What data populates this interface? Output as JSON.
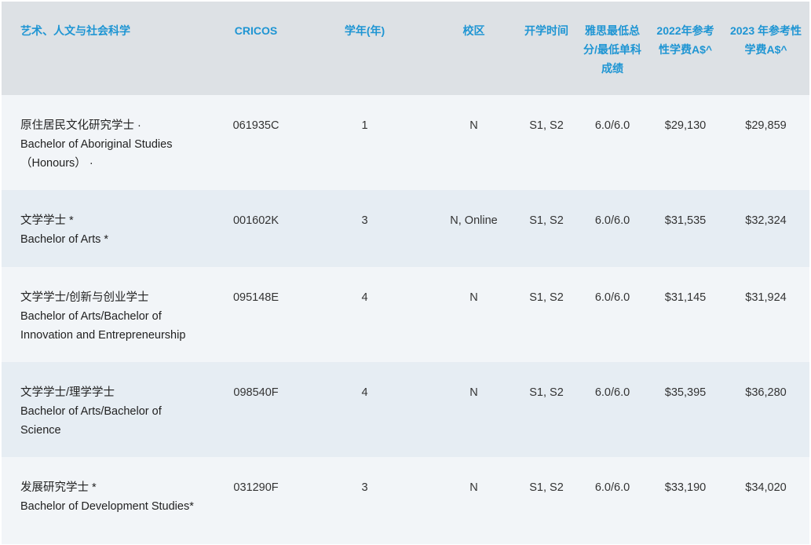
{
  "table": {
    "headers": {
      "program": "艺术、人文与社会科学",
      "cricos": "CRICOS",
      "years": "学年(年)",
      "campus": "校区",
      "intake": "开学时间",
      "ielts": "雅思最低总分/最低单科成绩",
      "fee2022": "2022年参考性学费A$^",
      "fee2023": "2023 年参考性学费A$^"
    },
    "rows": [
      {
        "name_cn": "原住居民文化研究学士 ·",
        "name_en": "Bachelor of Aboriginal Studies （Honours） ·",
        "cricos": "061935C",
        "years": "1",
        "campus": "N",
        "intake": "S1, S2",
        "ielts": "6.0/6.0",
        "fee2022": "$29,130",
        "fee2023": "$29,859"
      },
      {
        "name_cn": "文学学士 *",
        "name_en": "Bachelor of Arts *",
        "cricos": "001602K",
        "years": "3",
        "campus": "N, Online",
        "intake": "S1, S2",
        "ielts": "6.0/6.0",
        "fee2022": "$31,535",
        "fee2023": "$32,324"
      },
      {
        "name_cn": "文学学士/创新与创业学士",
        "name_en": "Bachelor of Arts/Bachelor of Innovation and Entrepreneurship",
        "cricos": "095148E",
        "years": "4",
        "campus": "N",
        "intake": "S1, S2",
        "ielts": "6.0/6.0",
        "fee2022": "$31,145",
        "fee2023": "$31,924"
      },
      {
        "name_cn": "文学学士/理学学士",
        "name_en": "Bachelor of Arts/Bachelor of Science",
        "cricos": "098540F",
        "years": "4",
        "campus": "N",
        "intake": "S1, S2",
        "ielts": "6.0/6.0",
        "fee2022": "$35,395",
        "fee2023": "$36,280"
      },
      {
        "name_cn": "发展研究学士 *",
        "name_en": "Bachelor of Development Studies*",
        "cricos": "031290F",
        "years": "3",
        "campus": "N",
        "intake": "S1, S2",
        "ielts": "6.0/6.0",
        "fee2022": "$33,190",
        "fee2023": "$34,020"
      }
    ]
  }
}
